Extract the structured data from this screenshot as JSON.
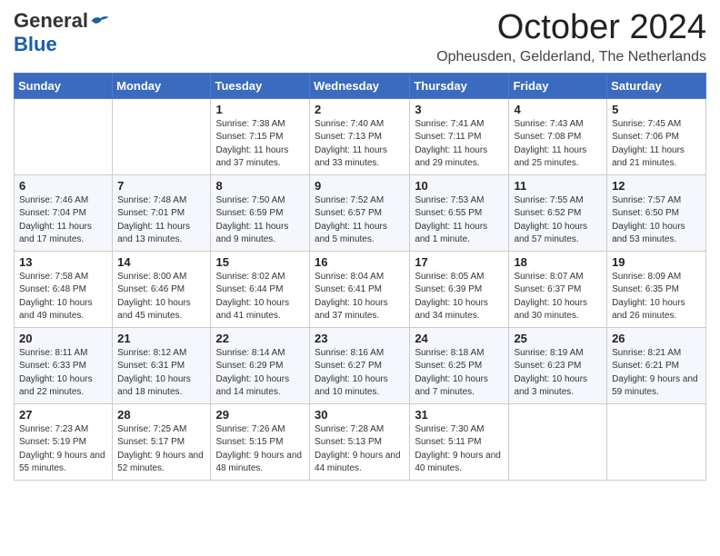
{
  "header": {
    "logo_general": "General",
    "logo_blue": "Blue",
    "month_title": "October 2024",
    "location": "Opheusden, Gelderland, The Netherlands"
  },
  "days_of_week": [
    "Sunday",
    "Monday",
    "Tuesday",
    "Wednesday",
    "Thursday",
    "Friday",
    "Saturday"
  ],
  "weeks": [
    [
      {
        "day": "",
        "content": ""
      },
      {
        "day": "",
        "content": ""
      },
      {
        "day": "1",
        "content": "Sunrise: 7:38 AM\nSunset: 7:15 PM\nDaylight: 11 hours and 37 minutes."
      },
      {
        "day": "2",
        "content": "Sunrise: 7:40 AM\nSunset: 7:13 PM\nDaylight: 11 hours and 33 minutes."
      },
      {
        "day": "3",
        "content": "Sunrise: 7:41 AM\nSunset: 7:11 PM\nDaylight: 11 hours and 29 minutes."
      },
      {
        "day": "4",
        "content": "Sunrise: 7:43 AM\nSunset: 7:08 PM\nDaylight: 11 hours and 25 minutes."
      },
      {
        "day": "5",
        "content": "Sunrise: 7:45 AM\nSunset: 7:06 PM\nDaylight: 11 hours and 21 minutes."
      }
    ],
    [
      {
        "day": "6",
        "content": "Sunrise: 7:46 AM\nSunset: 7:04 PM\nDaylight: 11 hours and 17 minutes."
      },
      {
        "day": "7",
        "content": "Sunrise: 7:48 AM\nSunset: 7:01 PM\nDaylight: 11 hours and 13 minutes."
      },
      {
        "day": "8",
        "content": "Sunrise: 7:50 AM\nSunset: 6:59 PM\nDaylight: 11 hours and 9 minutes."
      },
      {
        "day": "9",
        "content": "Sunrise: 7:52 AM\nSunset: 6:57 PM\nDaylight: 11 hours and 5 minutes."
      },
      {
        "day": "10",
        "content": "Sunrise: 7:53 AM\nSunset: 6:55 PM\nDaylight: 11 hours and 1 minute."
      },
      {
        "day": "11",
        "content": "Sunrise: 7:55 AM\nSunset: 6:52 PM\nDaylight: 10 hours and 57 minutes."
      },
      {
        "day": "12",
        "content": "Sunrise: 7:57 AM\nSunset: 6:50 PM\nDaylight: 10 hours and 53 minutes."
      }
    ],
    [
      {
        "day": "13",
        "content": "Sunrise: 7:58 AM\nSunset: 6:48 PM\nDaylight: 10 hours and 49 minutes."
      },
      {
        "day": "14",
        "content": "Sunrise: 8:00 AM\nSunset: 6:46 PM\nDaylight: 10 hours and 45 minutes."
      },
      {
        "day": "15",
        "content": "Sunrise: 8:02 AM\nSunset: 6:44 PM\nDaylight: 10 hours and 41 minutes."
      },
      {
        "day": "16",
        "content": "Sunrise: 8:04 AM\nSunset: 6:41 PM\nDaylight: 10 hours and 37 minutes."
      },
      {
        "day": "17",
        "content": "Sunrise: 8:05 AM\nSunset: 6:39 PM\nDaylight: 10 hours and 34 minutes."
      },
      {
        "day": "18",
        "content": "Sunrise: 8:07 AM\nSunset: 6:37 PM\nDaylight: 10 hours and 30 minutes."
      },
      {
        "day": "19",
        "content": "Sunrise: 8:09 AM\nSunset: 6:35 PM\nDaylight: 10 hours and 26 minutes."
      }
    ],
    [
      {
        "day": "20",
        "content": "Sunrise: 8:11 AM\nSunset: 6:33 PM\nDaylight: 10 hours and 22 minutes."
      },
      {
        "day": "21",
        "content": "Sunrise: 8:12 AM\nSunset: 6:31 PM\nDaylight: 10 hours and 18 minutes."
      },
      {
        "day": "22",
        "content": "Sunrise: 8:14 AM\nSunset: 6:29 PM\nDaylight: 10 hours and 14 minutes."
      },
      {
        "day": "23",
        "content": "Sunrise: 8:16 AM\nSunset: 6:27 PM\nDaylight: 10 hours and 10 minutes."
      },
      {
        "day": "24",
        "content": "Sunrise: 8:18 AM\nSunset: 6:25 PM\nDaylight: 10 hours and 7 minutes."
      },
      {
        "day": "25",
        "content": "Sunrise: 8:19 AM\nSunset: 6:23 PM\nDaylight: 10 hours and 3 minutes."
      },
      {
        "day": "26",
        "content": "Sunrise: 8:21 AM\nSunset: 6:21 PM\nDaylight: 9 hours and 59 minutes."
      }
    ],
    [
      {
        "day": "27",
        "content": "Sunrise: 7:23 AM\nSunset: 5:19 PM\nDaylight: 9 hours and 55 minutes."
      },
      {
        "day": "28",
        "content": "Sunrise: 7:25 AM\nSunset: 5:17 PM\nDaylight: 9 hours and 52 minutes."
      },
      {
        "day": "29",
        "content": "Sunrise: 7:26 AM\nSunset: 5:15 PM\nDaylight: 9 hours and 48 minutes."
      },
      {
        "day": "30",
        "content": "Sunrise: 7:28 AM\nSunset: 5:13 PM\nDaylight: 9 hours and 44 minutes."
      },
      {
        "day": "31",
        "content": "Sunrise: 7:30 AM\nSunset: 5:11 PM\nDaylight: 9 hours and 40 minutes."
      },
      {
        "day": "",
        "content": ""
      },
      {
        "day": "",
        "content": ""
      }
    ]
  ]
}
